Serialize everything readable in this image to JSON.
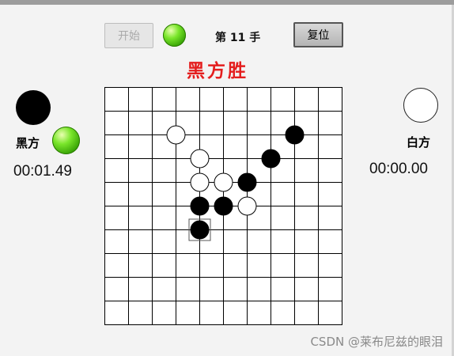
{
  "controls": {
    "start_label": "开始",
    "move_counter": "第 11 手",
    "reset_label": "复位"
  },
  "status": {
    "winner_text": "黑方胜",
    "winner_color": "#e41e1e"
  },
  "players": {
    "black": {
      "name": "黑方",
      "time": "00:01.49",
      "active_indicator": "green-led"
    },
    "white": {
      "name": "白方",
      "time": "00:00.00"
    }
  },
  "board": {
    "size": 10,
    "stones": [
      {
        "col": 3,
        "row": 2,
        "color": "white"
      },
      {
        "col": 4,
        "row": 3,
        "color": "white"
      },
      {
        "col": 4,
        "row": 4,
        "color": "white"
      },
      {
        "col": 5,
        "row": 4,
        "color": "white"
      },
      {
        "col": 6,
        "row": 5,
        "color": "white"
      },
      {
        "col": 8,
        "row": 2,
        "color": "black"
      },
      {
        "col": 7,
        "row": 3,
        "color": "black"
      },
      {
        "col": 6,
        "row": 4,
        "color": "black"
      },
      {
        "col": 4,
        "row": 5,
        "color": "black"
      },
      {
        "col": 5,
        "row": 5,
        "color": "black"
      },
      {
        "col": 4,
        "row": 6,
        "color": "black"
      }
    ],
    "last_move": {
      "col": 4,
      "row": 6
    }
  },
  "watermark": "CSDN @莱布尼兹的眼泪"
}
